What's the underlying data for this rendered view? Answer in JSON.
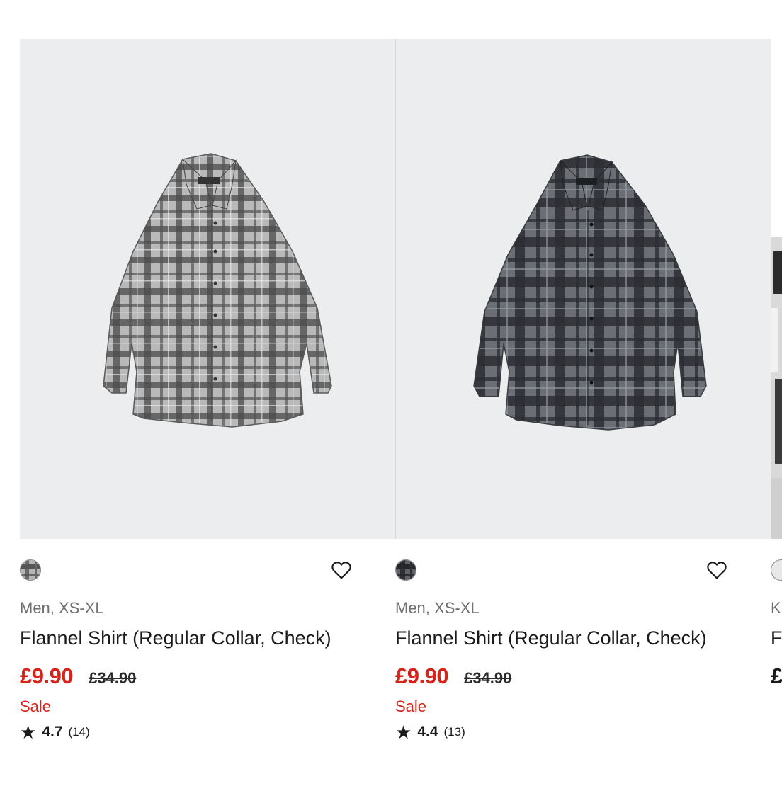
{
  "products": [
    {
      "category": "Men, XS-XL",
      "name": "Flannel Shirt (Regular Collar, Check)",
      "price": "£9.90",
      "original_price": "£34.90",
      "badge": "Sale",
      "rating": "4.7",
      "review_count": "(14)",
      "swatch_color": "light grey check",
      "colors": {
        "accent": "#d4251c"
      }
    },
    {
      "category": "Men, XS-XL",
      "name": "Flannel Shirt (Regular Collar, Check)",
      "price": "£9.90",
      "original_price": "£34.90",
      "badge": "Sale",
      "rating": "4.4",
      "review_count": "(13)",
      "swatch_color": "dark grey check",
      "colors": {
        "accent": "#d4251c"
      }
    },
    {
      "category": "K",
      "name": "F",
      "price": "£"
    }
  ],
  "icons": {
    "wishlist": "heart-outline-icon",
    "rating": "star-icon"
  }
}
